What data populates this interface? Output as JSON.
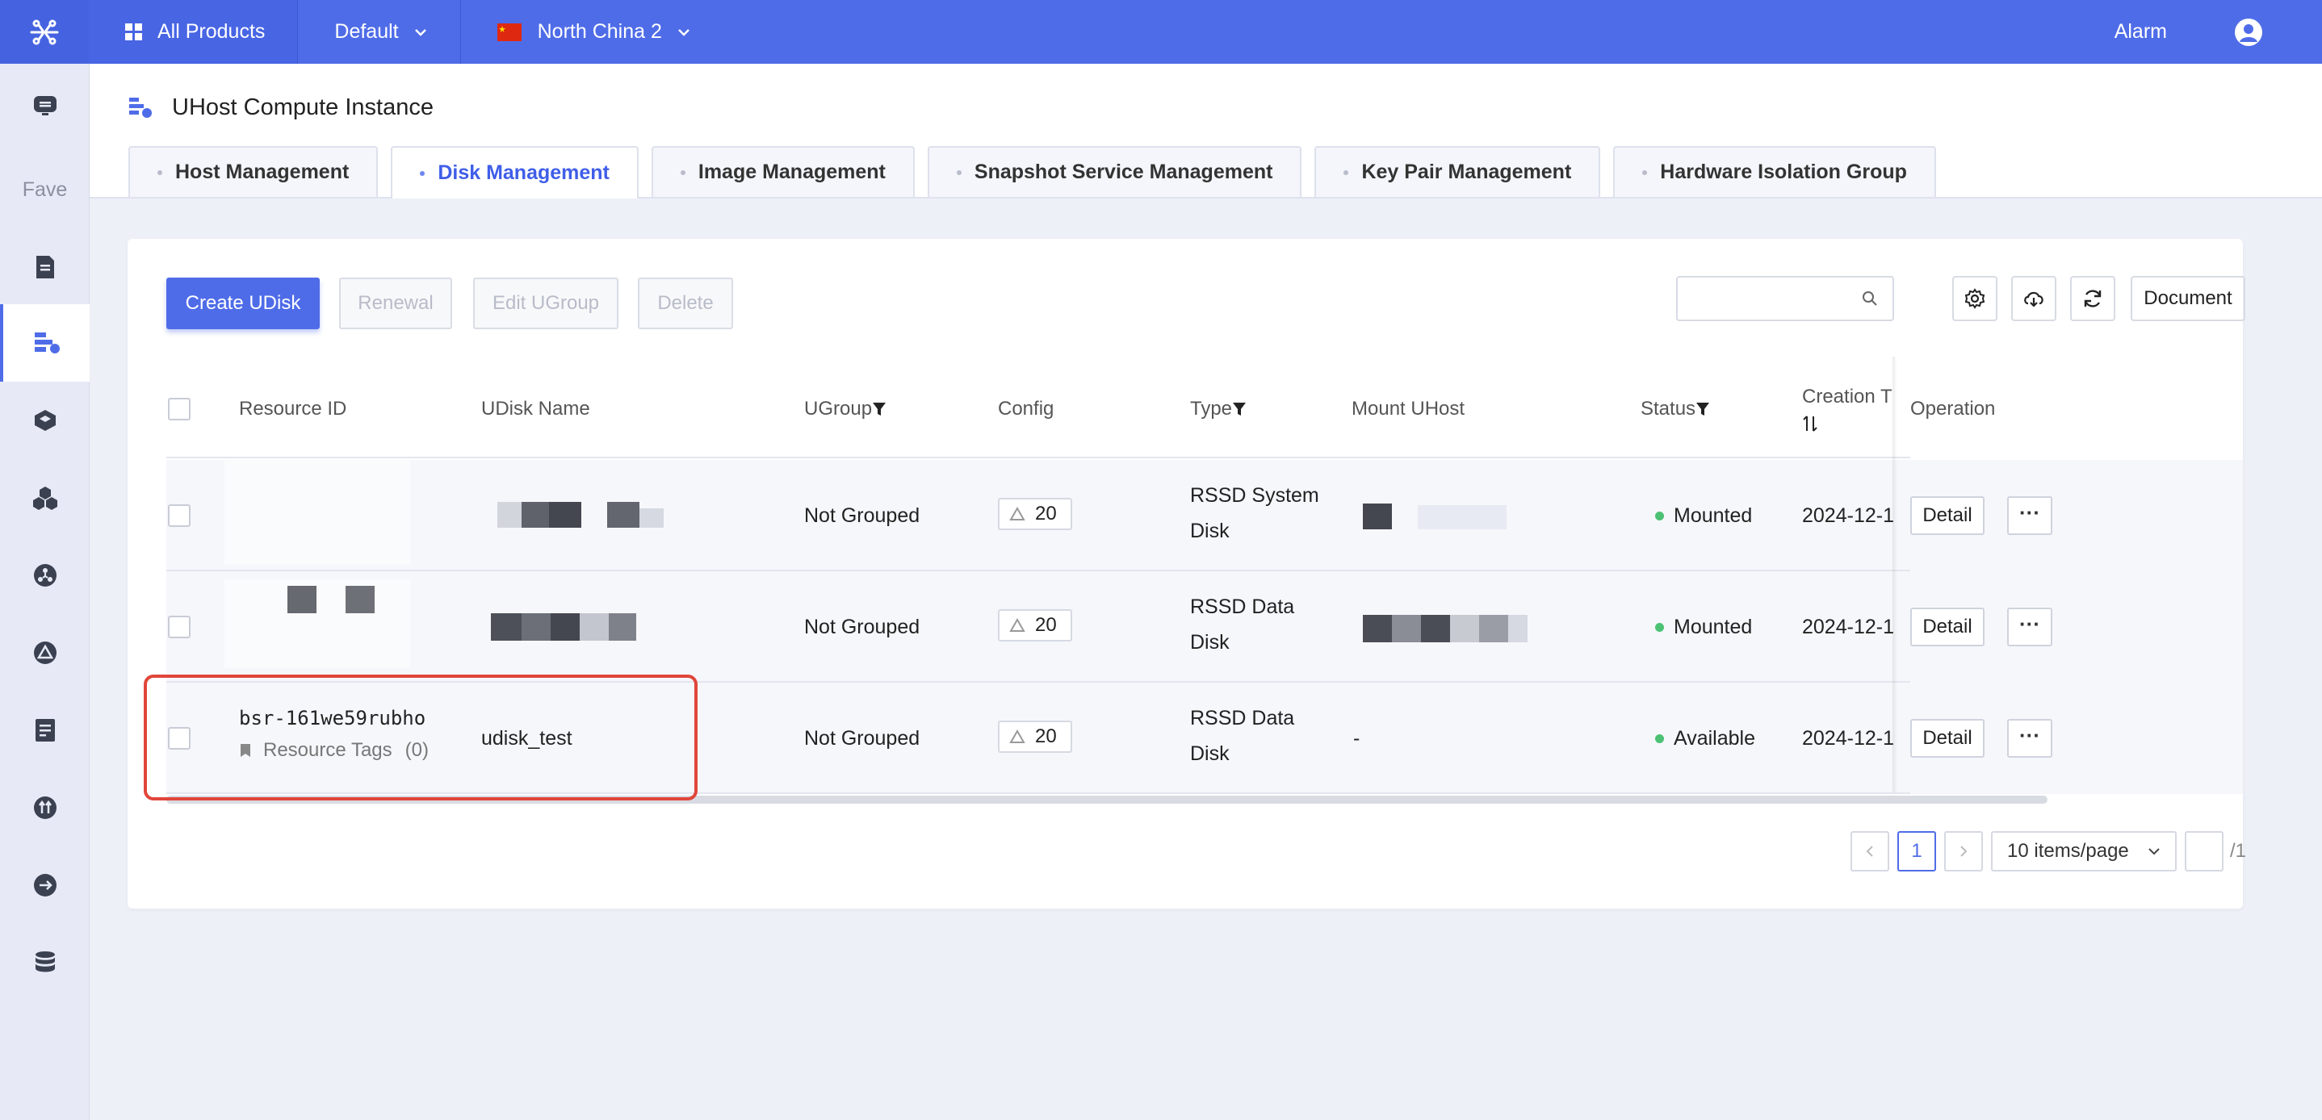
{
  "topbar": {
    "all_products": "All Products",
    "project": "Default",
    "region": "North China 2",
    "alarm": "Alarm"
  },
  "sidebar": {
    "fave": "Fave"
  },
  "page": {
    "title": "UHost Compute Instance"
  },
  "tabs": [
    {
      "label": "Host Management"
    },
    {
      "label": "Disk Management",
      "active": true
    },
    {
      "label": "Image Management"
    },
    {
      "label": "Snapshot Service Management"
    },
    {
      "label": "Key Pair Management"
    },
    {
      "label": "Hardware Isolation Group"
    }
  ],
  "toolbar": {
    "create": "Create UDisk",
    "renewal": "Renewal",
    "edit_ugroup": "Edit UGroup",
    "delete": "Delete",
    "search_placeholder": "",
    "document": "Document"
  },
  "table": {
    "headers": {
      "resource_id": "Resource ID",
      "udisk_name": "UDisk Name",
      "ugroup": "UGroup",
      "config": "Config",
      "type": "Type",
      "mount_uhost": "Mount UHost",
      "status": "Status",
      "creation": "Creation T",
      "operation": "Operation"
    },
    "rows": [
      {
        "resource_id": "",
        "name": "",
        "ugroup": "Not Grouped",
        "config": "20",
        "type_line1": "RSSD System",
        "type_line2": "Disk",
        "mount": "",
        "status": "Mounted",
        "creation": "2024-12-1",
        "detail": "Detail",
        "more": "···"
      },
      {
        "resource_id": "",
        "name": "",
        "ugroup": "Not Grouped",
        "config": "20",
        "type_line1": "RSSD Data",
        "type_line2": "Disk",
        "mount": "",
        "status": "Mounted",
        "creation": "2024-12-1",
        "detail": "Detail",
        "more": "···"
      },
      {
        "resource_id": "bsr-161we59rubho",
        "tags_label": "Resource Tags",
        "tags_count": "(0)",
        "name": "udisk_test",
        "ugroup": "Not Grouped",
        "config": "20",
        "type_line1": "RSSD Data",
        "type_line2": "Disk",
        "mount": "-",
        "status": "Available",
        "creation": "2024-12-1",
        "detail": "Detail",
        "more": "···"
      }
    ]
  },
  "pagination": {
    "current": "1",
    "page_size": "10 items/page",
    "total": "/1"
  },
  "colors": {
    "primary": "#4f6ce8",
    "highlight": "#e0463a",
    "status_ok": "#4cc174"
  }
}
